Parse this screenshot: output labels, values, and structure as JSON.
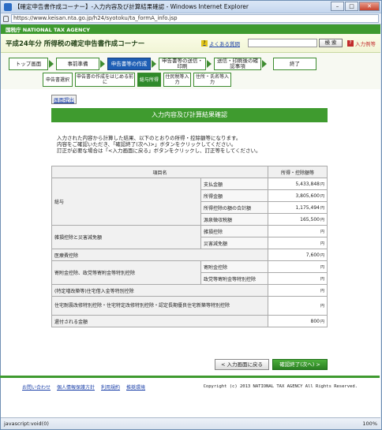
{
  "window": {
    "title": "【確定申告書作成コーナー】-入力内容及び計算結果確認 - Windows Internet Explorer",
    "url": "https://www.keisan.nta.go.jp/h24/syotoku/ta_formA_info.jsp"
  },
  "header": {
    "agency": "国税庁  NATIONAL TAX AGENCY",
    "page_title": "平成24年分  所得税の確定申告書作成コーナー",
    "faq_label": "よくある質問",
    "search_button": "検 索",
    "howto_label": "入力例等"
  },
  "steps": [
    {
      "label": "トップ画面"
    },
    {
      "label": "事前準備"
    },
    {
      "label": "申告書等の作成"
    },
    {
      "label": "申告書等の送信・印刷"
    },
    {
      "label": "送信・印刷後の確認事項"
    },
    {
      "label": "終了"
    }
  ],
  "substeps": [
    {
      "label": "申告書選択"
    },
    {
      "label": "申告書の作成をはじめる前に"
    },
    {
      "label": "総与所得"
    },
    {
      "label": "住民税等入力"
    },
    {
      "label": "住所・氏名等入力"
    }
  ],
  "shoumei_link": "画面提出",
  "section_title": "入力内容及び計算結果確認",
  "intro": [
    "入力された内容から計算した結果、以下のとおりの所得・控除額等になります。",
    "内容をご確認いただき、「確認終了(次へ)>」ボタンをクリックしてください。",
    "訂正が必要な場合は「<入力画面に戻る」ボタンをクリックし、訂正等をしてください。"
  ],
  "table": {
    "headers": [
      "項目名",
      "所得・控除額等"
    ],
    "rows": [
      {
        "cat": "総与",
        "sub": "支払金額",
        "val": "5,433,848"
      },
      {
        "cat": "",
        "sub": "所得金額",
        "val": "3,805,600"
      },
      {
        "cat": "",
        "sub": "所得控除の額の合計額",
        "val": "1,175,494"
      },
      {
        "cat": "",
        "sub": "源泉徴収税額",
        "val": "165,500"
      },
      {
        "cat": "雑損控除と災害減免額",
        "sub": "雑損控除",
        "val": ""
      },
      {
        "cat": "",
        "sub": "災害減免額",
        "val": ""
      },
      {
        "cat": "医療費控除",
        "sub": "",
        "val": "7,600"
      },
      {
        "cat": "寄附金控除、政党等寄附金等特別控除",
        "sub": "寄附金控除",
        "val": ""
      },
      {
        "cat": "",
        "sub": "政党等寄附金等特別控除",
        "val": ""
      },
      {
        "cat": "(特定増改築等)住宅借入金等特別控除",
        "sub": "",
        "val": ""
      },
      {
        "cat": "住宅耐震改修特別控除・住宅特定改修特別控除・認定長期優良住宅新築等特別控除",
        "sub": "",
        "val": ""
      },
      {
        "cat": "還付される金額",
        "sub": "",
        "val": "800"
      }
    ],
    "yen": "円"
  },
  "buttons": {
    "back": "< 入力画面に戻る",
    "next": "確認終了(次へ) >"
  },
  "footer": {
    "links": [
      "お問い合わせ",
      "個人情報保護方針",
      "利用規約",
      "推奨環境"
    ],
    "copyright": "Copyright (c) 2013 NATIONAL TAX AGENCY All Rights Reserved."
  },
  "status": {
    "text": "javascript:void(0)",
    "zoom": "100%"
  }
}
